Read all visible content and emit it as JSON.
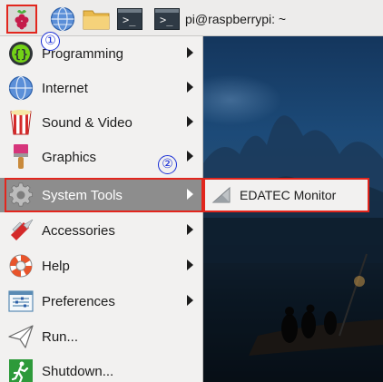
{
  "taskbar": {
    "task_label": "pi@raspberrypi: ~",
    "raspberry_marker": "①",
    "terminal_prompt": ">_"
  },
  "menu": {
    "items": [
      {
        "label": "Programming",
        "icon": "programming-icon",
        "has_submenu": true
      },
      {
        "label": "Internet",
        "icon": "globe-icon",
        "has_submenu": true
      },
      {
        "label": "Sound & Video",
        "icon": "sound-video-icon",
        "has_submenu": true
      },
      {
        "label": "Graphics",
        "icon": "paint-brush-icon",
        "has_submenu": true
      },
      {
        "label": "System Tools",
        "icon": "gear-icon",
        "has_submenu": true,
        "selected": true
      },
      {
        "label": "Accessories",
        "icon": "pocket-knife-icon",
        "has_submenu": true
      },
      {
        "label": "Help",
        "icon": "lifebuoy-icon",
        "has_submenu": true
      },
      {
        "label": "Preferences",
        "icon": "preferences-icon",
        "has_submenu": true
      },
      {
        "label": "Run...",
        "icon": "paper-plane-icon",
        "has_submenu": false
      },
      {
        "label": "Shutdown...",
        "icon": "exit-icon",
        "has_submenu": false
      }
    ],
    "graphics_marker": "②"
  },
  "submenu": {
    "item_label": "EDATEC Monitor",
    "icon": "monitor-app-icon"
  },
  "colors": {
    "highlight_border": "#e2261d",
    "marker": "#1a2fd6",
    "selected_bg": "#8d8d8d",
    "menu_bg": "#f2f1f0"
  }
}
